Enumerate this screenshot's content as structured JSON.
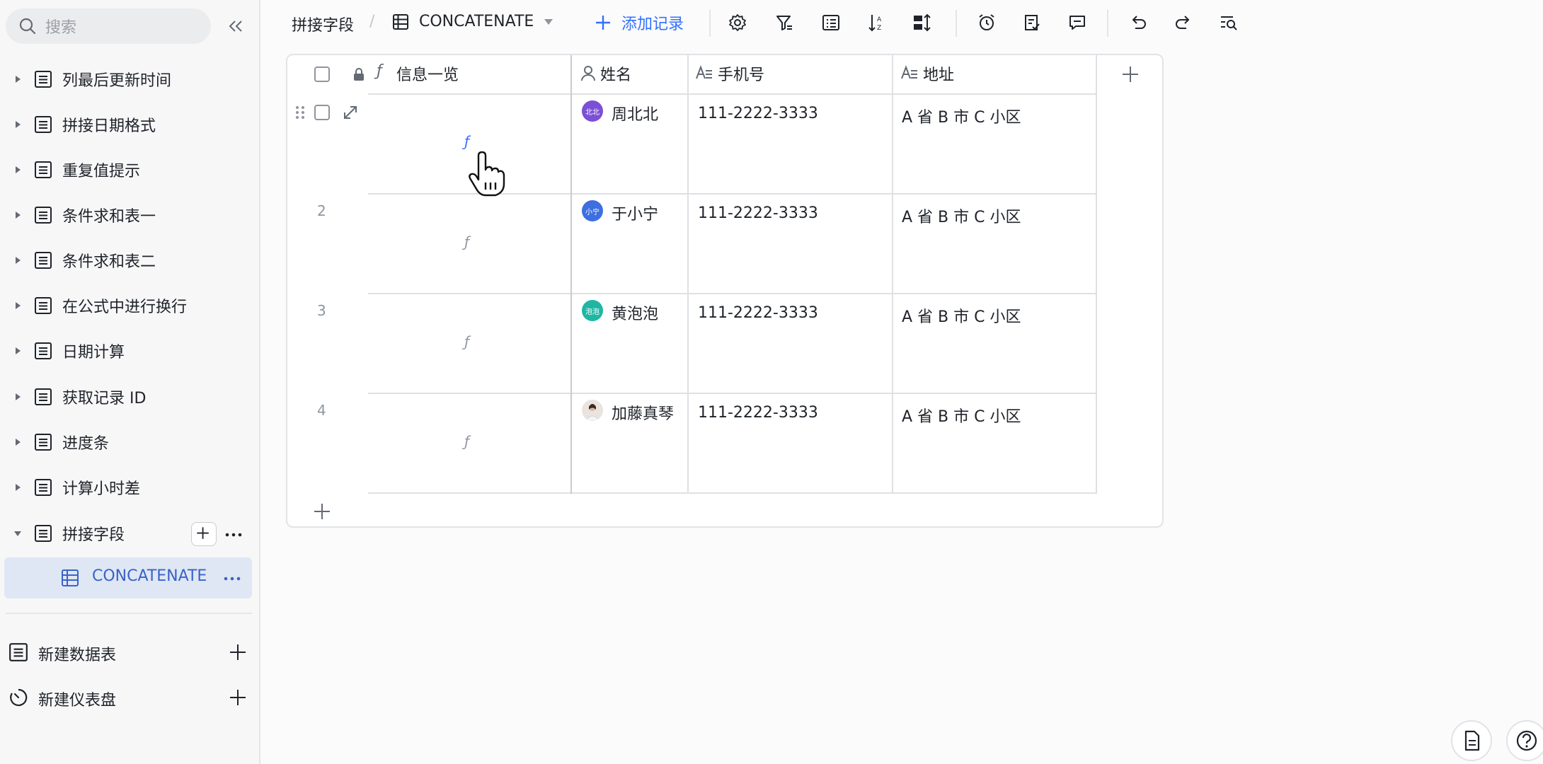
{
  "sidebar": {
    "search_placeholder": "搜索",
    "items": [
      {
        "label": "列最后更新时间"
      },
      {
        "label": "拼接日期格式"
      },
      {
        "label": "重复值提示"
      },
      {
        "label": "条件求和表一"
      },
      {
        "label": "条件求和表二"
      },
      {
        "label": "在公式中进行换行"
      },
      {
        "label": "日期计算"
      },
      {
        "label": "获取记录 ID"
      },
      {
        "label": "进度条"
      },
      {
        "label": "计算小时差"
      },
      {
        "label": "拼接字段"
      }
    ],
    "active_sub_item": "CONCATENATE",
    "new_table": "新建数据表",
    "new_dashboard": "新建仪表盘"
  },
  "toolbar": {
    "table_name": "拼接字段",
    "separator": "/",
    "view_name": "CONCATENATE",
    "add_record": "添加记录"
  },
  "grid": {
    "columns": [
      "信息一览",
      "姓名",
      "手机号",
      "地址"
    ],
    "formula_glyph": "ƒ",
    "rows": [
      {
        "num": "",
        "name": "周北北",
        "avatar_text": "北北",
        "avatar_color": "#7b4fd6",
        "phone": "111-2222-3333",
        "address": "A 省 B 市 C 小区"
      },
      {
        "num": "2",
        "name": "于小宁",
        "avatar_text": "小宁",
        "avatar_color": "#3d6fe0",
        "phone": "111-2222-3333",
        "address": "A 省 B 市 C 小区"
      },
      {
        "num": "3",
        "name": "黄泡泡",
        "avatar_text": "泡泡",
        "avatar_color": "#1fb7a4",
        "phone": "111-2222-3333",
        "address": "A 省 B 市 C 小区"
      },
      {
        "num": "4",
        "name": "加藤真琴",
        "avatar_text": "",
        "avatar_color": "#e9e4df",
        "phone": "111-2222-3333",
        "address": "A 省 B 市 C 小区"
      }
    ]
  },
  "colors": {
    "accent": "#3370ff",
    "active_bg": "#dfe7f5"
  }
}
